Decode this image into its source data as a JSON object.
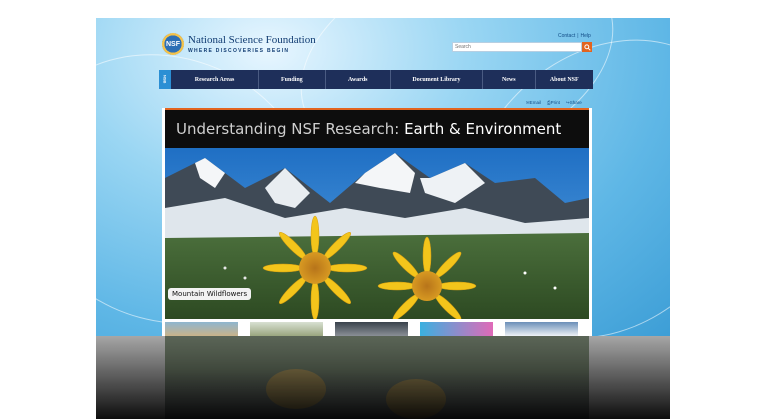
{
  "header": {
    "org_name": "National Science Foundation",
    "tagline": "WHERE DISCOVERIES BEGIN",
    "seal_text": "NSF",
    "utility_links": [
      "Contact",
      "|",
      "Help"
    ],
    "search_placeholder": "Search",
    "search_icon": "magnifier-icon"
  },
  "nav": {
    "badge": "NSB",
    "items": [
      "Research Areas",
      "Funding",
      "Awards",
      "Document Library",
      "News",
      "About NSF"
    ]
  },
  "share_links": [
    "Email",
    "Print",
    "Share"
  ],
  "main": {
    "title_prefix": "Understanding NSF Research:",
    "title_main": "Earth & Environment",
    "hero_caption": "Mountain Wildflowers"
  },
  "colors": {
    "nav_bg": "#1e2f5a",
    "accent_orange": "#e2641f",
    "sky_blue": "#5fb7e6"
  }
}
